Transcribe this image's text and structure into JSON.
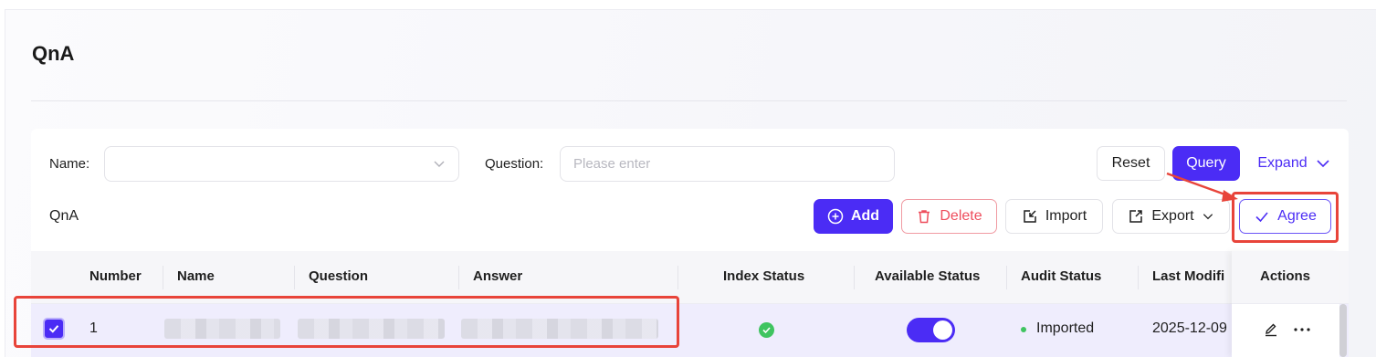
{
  "page": {
    "title": "QnA"
  },
  "filters": {
    "name_label": "Name",
    "name_value": "",
    "question_label": "Question",
    "question_placeholder": "Please enter"
  },
  "filter_actions": {
    "reset": "Reset",
    "query": "Query",
    "expand": "Expand"
  },
  "toolbar": {
    "section_label": "QnA",
    "add": "Add",
    "delete": "Delete",
    "import": "Import",
    "export": "Export",
    "agree": "Agree"
  },
  "table": {
    "columns": [
      "Number",
      "Name",
      "Question",
      "Answer",
      "Index Status",
      "Available Status",
      "Audit Status",
      "Last Modifi",
      "Actions"
    ],
    "rows": [
      {
        "selected": true,
        "number": "1",
        "name": "",
        "question": "",
        "answer": "",
        "index_status": "success",
        "available": true,
        "audit_status": "Imported",
        "last_modified": "2025-12-09"
      }
    ]
  },
  "colors": {
    "primary": "#4b2cf5",
    "danger": "#ee4d5c",
    "success": "#3fc460",
    "annotation": "#e8443a"
  },
  "icons": [
    "chevron-down-icon",
    "plus-circle-icon",
    "trash-icon",
    "import-icon",
    "export-icon",
    "check-icon",
    "edit-icon",
    "more-icon"
  ]
}
